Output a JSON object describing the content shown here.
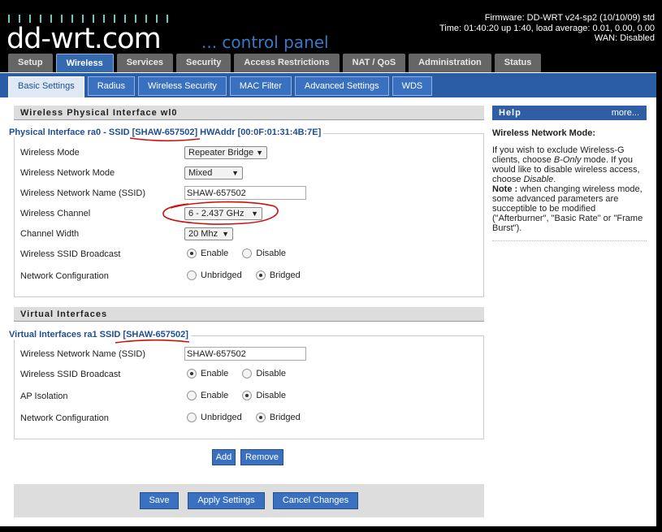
{
  "header": {
    "logo": "dd-wrt.com",
    "logo_sub": "... control panel",
    "firmware": "Firmware: DD-WRT v24-sp2 (10/10/09) std",
    "uptime": "Time: 01:40:20 up 1:40, load average: 0.01, 0.00, 0.00",
    "wan": "WAN: Disabled"
  },
  "tabs": [
    "Setup",
    "Wireless",
    "Services",
    "Security",
    "Access Restrictions",
    "NAT / QoS",
    "Administration",
    "Status"
  ],
  "subtabs": [
    "Basic Settings",
    "Radius",
    "Wireless Security",
    "MAC Filter",
    "Advanced Settings",
    "WDS"
  ],
  "physical": {
    "section_title": "Wireless Physical Interface wl0",
    "legend": "Physical Interface ra0 - SSID [SHAW-657502] HWAddr [00:0F:01:31:4B:7E]",
    "mode_label": "Wireless Mode",
    "mode_value": "Repeater Bridge",
    "netmode_label": "Wireless Network Mode",
    "netmode_value": "Mixed",
    "ssid_label": "Wireless Network Name (SSID)",
    "ssid_value": "SHAW-657502",
    "channel_label": "Wireless Channel",
    "channel_value": "6 - 2.437 GHz",
    "width_label": "Channel Width",
    "width_value": "20 Mhz",
    "broadcast_label": "Wireless SSID Broadcast",
    "enable": "Enable",
    "disable": "Disable",
    "netconfig_label": "Network Configuration",
    "unbridged": "Unbridged",
    "bridged": "Bridged"
  },
  "virtual": {
    "section_title": "Virtual Interfaces",
    "legend": "Virtual Interfaces ra1 SSID [SHAW-657502]",
    "ssid_label": "Wireless Network Name (SSID)",
    "ssid_value": "SHAW-657502",
    "broadcast_label": "Wireless SSID Broadcast",
    "isolation_label": "AP Isolation",
    "netconfig_label": "Network Configuration",
    "enable": "Enable",
    "disable": "Disable",
    "unbridged": "Unbridged",
    "bridged": "Bridged",
    "add": "Add",
    "remove": "Remove"
  },
  "footer": {
    "save": "Save",
    "apply": "Apply Settings",
    "cancel": "Cancel Changes"
  },
  "help": {
    "title": "Help",
    "more": "more...",
    "heading": "Wireless Network Mode:",
    "p1": "If you wish to exclude Wireless-G clients, choose ",
    "p1_em": "B-Only",
    "p1_mid": " mode. If you would like to disable wireless access, choose ",
    "p1_em2": "Disable",
    "p1_end": ".",
    "note_label": "Note :",
    "note": " when changing wireless mode, some advanced parameters are succeptible to be modified (\"Afterburner\", \"Basic Rate\" or \"Frame Burst\")."
  },
  "colors": {
    "accent": "#2a5da5",
    "annotation": "#cc1111"
  }
}
